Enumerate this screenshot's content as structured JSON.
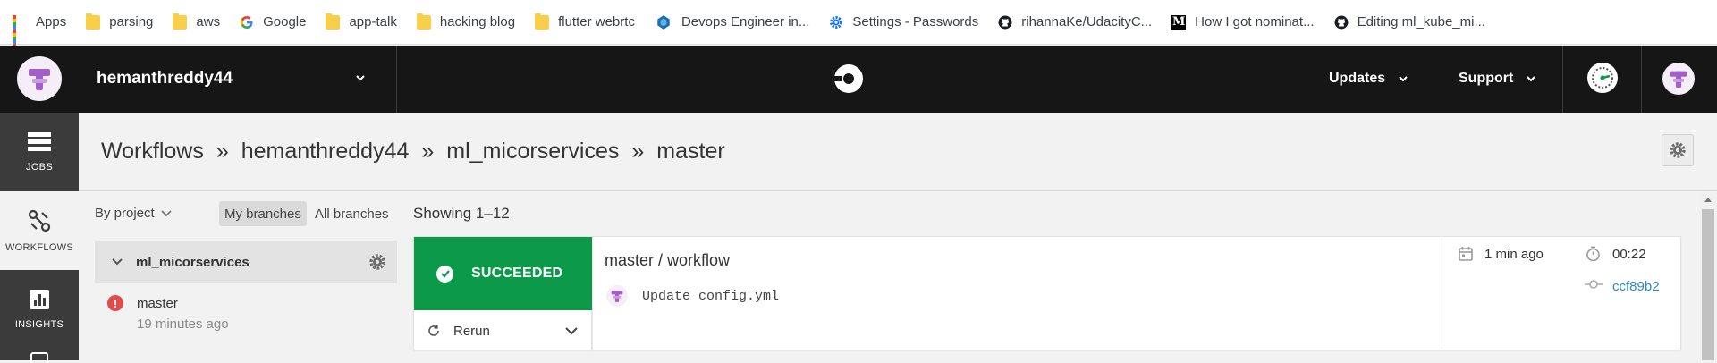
{
  "bookmarks": [
    {
      "label": "Apps",
      "icon": "apps-grid-icon"
    },
    {
      "label": "parsing",
      "icon": "folder-icon"
    },
    {
      "label": "aws",
      "icon": "folder-icon"
    },
    {
      "label": "Google",
      "icon": "google-icon"
    },
    {
      "label": "app-talk",
      "icon": "folder-icon"
    },
    {
      "label": "hacking blog",
      "icon": "folder-icon"
    },
    {
      "label": "flutter webrtc",
      "icon": "folder-icon"
    },
    {
      "label": "Devops Engineer in...",
      "icon": "devops-icon"
    },
    {
      "label": "Settings - Passwords",
      "icon": "gear-icon"
    },
    {
      "label": "rihannaKe/UdacityC...",
      "icon": "github-icon"
    },
    {
      "label": "How I got nominat...",
      "icon": "medium-icon"
    },
    {
      "label": "Editing ml_kube_mi...",
      "icon": "github-icon"
    }
  ],
  "topnav": {
    "org": "hemanthreddy44",
    "updates": "Updates",
    "support": "Support"
  },
  "sidenav": {
    "jobs": "JOBS",
    "workflows": "WORKFLOWS",
    "insights": "INSIGHTS"
  },
  "breadcrumb": [
    "Workflows",
    "hemanthreddy44",
    "ml_micorservices",
    "master"
  ],
  "breadcrumb_sep": "»",
  "filters": {
    "by_project": "By project",
    "my_branches": "My branches",
    "all_branches": "All branches"
  },
  "project": {
    "name": "ml_micorservices",
    "branch": "master",
    "branch_time": "19 minutes ago",
    "branch_status_symbol": "!"
  },
  "list": {
    "showing": "Showing 1–12"
  },
  "workflow": {
    "status": "SUCCEEDED",
    "rerun": "Rerun",
    "title": "master / workflow",
    "commit_message": "Update config.yml",
    "time_ago": "1 min ago",
    "duration": "00:22",
    "commit_hash": "ccf89b2"
  },
  "colors": {
    "success": "#0c9a4a",
    "nav_bg": "#161616",
    "side_bg": "#3b3b3b",
    "link": "#2f86c6",
    "error": "#e04c4c"
  }
}
